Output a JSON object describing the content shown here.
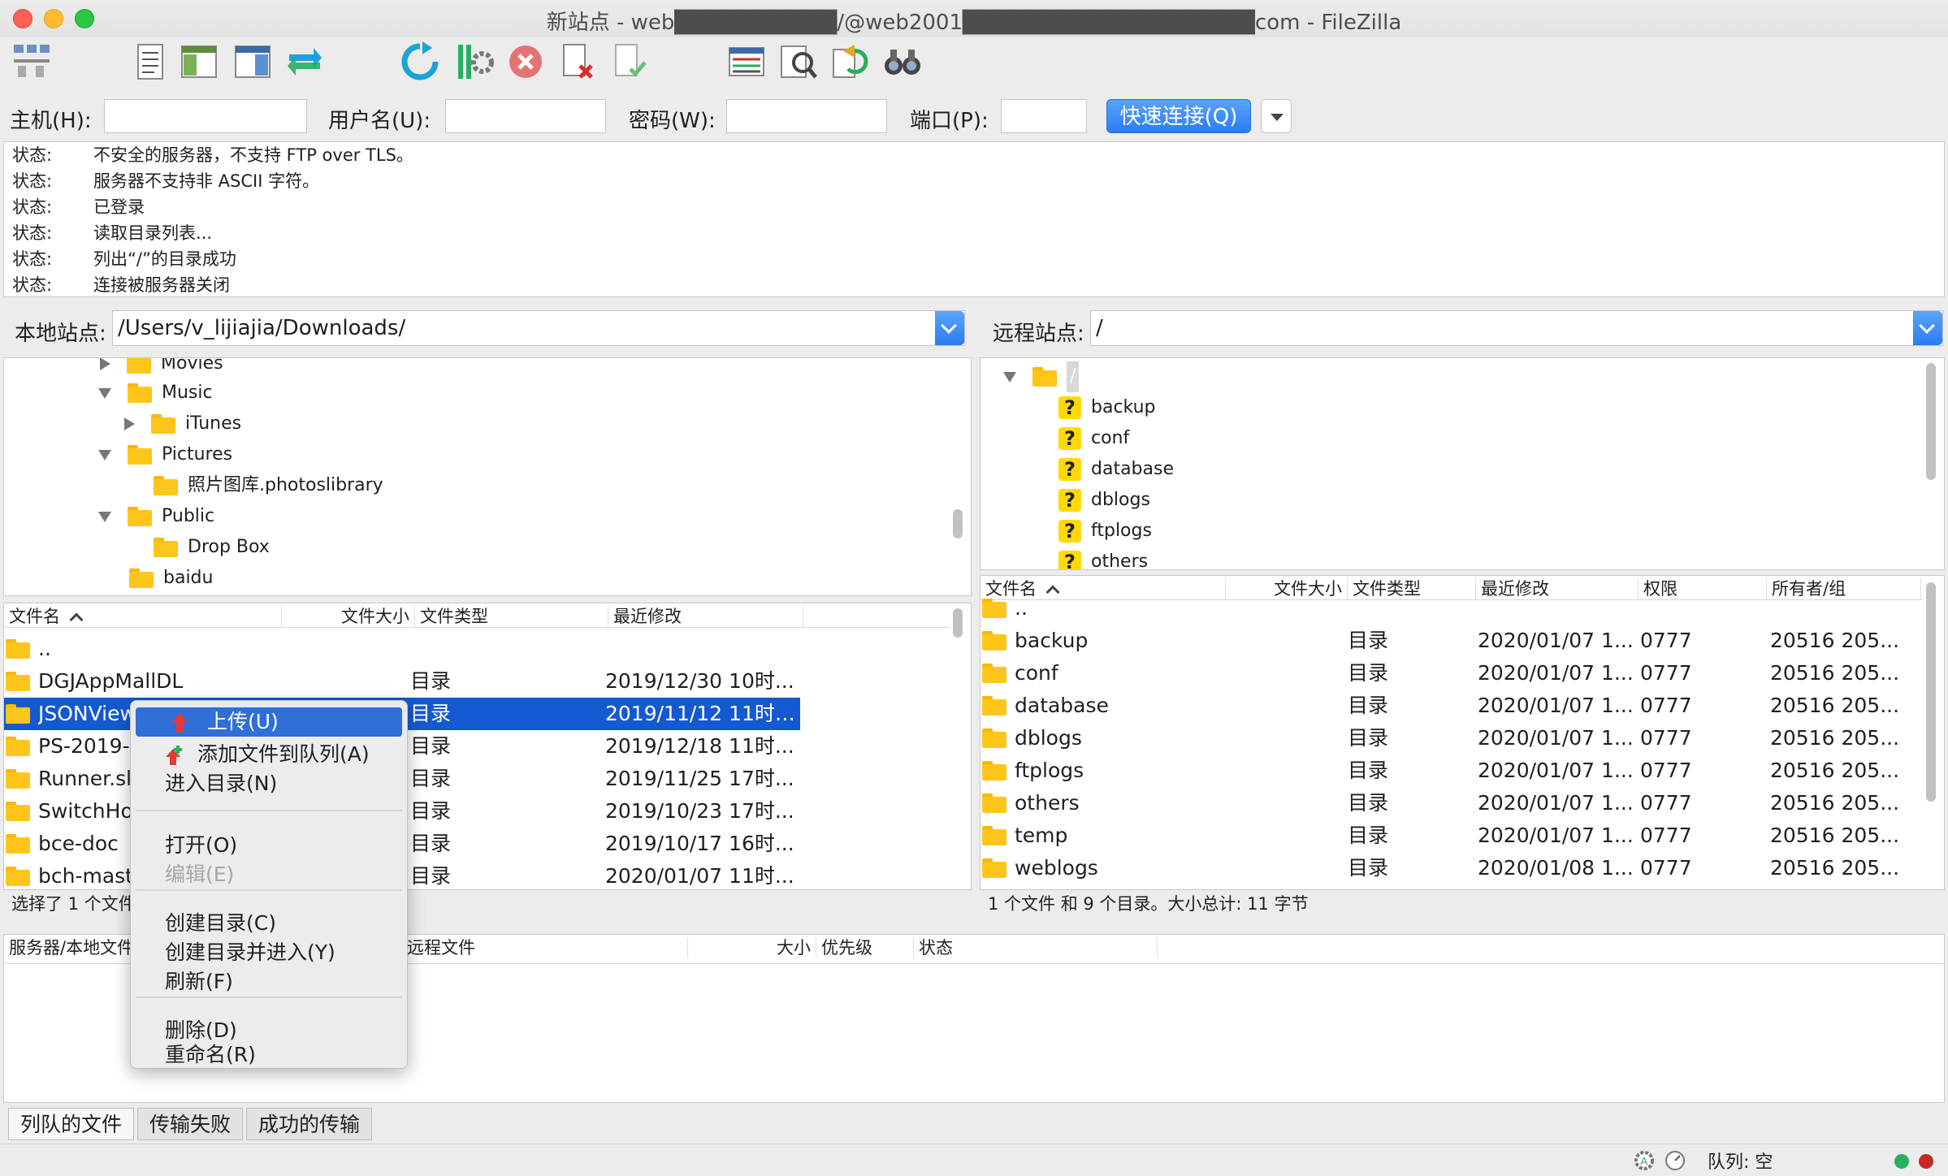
{
  "window": {
    "title": "新站点 - web██████████/@web2001██████████████████com - FileZilla"
  },
  "toolbar": {
    "icons": [
      "site-manager-icon",
      "message-log-icon",
      "local-tree-icon",
      "remote-tree-icon",
      "transfer-queue-icon",
      "refresh-icon",
      "process-queue-icon",
      "cancel-icon",
      "disconnect-icon",
      "reconnect-icon",
      "directory-listing-filters-icon",
      "toggle-sync-browsing-icon",
      "sync-icon",
      "search-icon"
    ]
  },
  "quickconnect": {
    "host_label": "主机(H):",
    "host_value": "",
    "user_label": "用户名(U):",
    "user_value": "",
    "password_label": "密码(W):",
    "password_value": "",
    "port_label": "端口(P):",
    "port_value": "",
    "connect_button": "快速连接(Q)"
  },
  "log": [
    {
      "key": "状态:",
      "msg": "不安全的服务器，不支持 FTP over TLS。"
    },
    {
      "key": "状态:",
      "msg": "服务器不支持非 ASCII 字符。"
    },
    {
      "key": "状态:",
      "msg": "已登录"
    },
    {
      "key": "状态:",
      "msg": "读取目录列表..."
    },
    {
      "key": "状态:",
      "msg": "列出“/”的目录成功"
    },
    {
      "key": "状态:",
      "msg": "连接被服务器关闭"
    }
  ],
  "local": {
    "site_label": "本地站点:",
    "path": "/Users/v_lijiajia/Downloads/",
    "tree": [
      "Movies",
      "Music",
      "iTunes",
      "Pictures",
      "照片图库.photoslibrary",
      "Public",
      "Drop Box",
      "baidu"
    ],
    "headers": {
      "name": "文件名",
      "size": "文件大小",
      "type": "文件类型",
      "modified": "最近修改"
    },
    "files": [
      {
        "name": "..",
        "type": "",
        "modified": ""
      },
      {
        "name": "DGJAppMallDL",
        "type": "目录",
        "modified": "2019/12/30 10时..."
      },
      {
        "name": "JSONView",
        "type": "目录",
        "modified": "2019/11/12 11时1..."
      },
      {
        "name": "PS-2019-",
        "type": "目录",
        "modified": "2019/12/18 11时..."
      },
      {
        "name": "Runner.sk",
        "type": "目录",
        "modified": "2019/11/25 17时..."
      },
      {
        "name": "SwitchHo",
        "type": "目录",
        "modified": "2019/10/23 17时..."
      },
      {
        "name": "bce-doc",
        "type": "目录",
        "modified": "2019/10/17 16时..."
      },
      {
        "name": "bch-mast",
        "type": "目录",
        "modified": "2020/01/07 11时..."
      }
    ],
    "status": "选择了 1 个文件"
  },
  "remote": {
    "site_label": "远程站点:",
    "path": "/",
    "tree_root": "/",
    "tree": [
      "backup",
      "conf",
      "database",
      "dblogs",
      "ftplogs",
      "others"
    ],
    "headers": {
      "name": "文件名",
      "size": "文件大小",
      "type": "文件类型",
      "modified": "最近修改",
      "perms": "权限",
      "owner": "所有者/组"
    },
    "files": [
      {
        "name": "..",
        "type": "",
        "modified": "",
        "perms": "",
        "owner": ""
      },
      {
        "name": "backup",
        "type": "目录",
        "modified": "2020/01/07 1...",
        "perms": "0777",
        "owner": "20516 205..."
      },
      {
        "name": "conf",
        "type": "目录",
        "modified": "2020/01/07 1...",
        "perms": "0777",
        "owner": "20516 205..."
      },
      {
        "name": "database",
        "type": "目录",
        "modified": "2020/01/07 1...",
        "perms": "0777",
        "owner": "20516 205..."
      },
      {
        "name": "dblogs",
        "type": "目录",
        "modified": "2020/01/07 1...",
        "perms": "0777",
        "owner": "20516 205..."
      },
      {
        "name": "ftplogs",
        "type": "目录",
        "modified": "2020/01/07 1...",
        "perms": "0777",
        "owner": "20516 205..."
      },
      {
        "name": "others",
        "type": "目录",
        "modified": "2020/01/07 1...",
        "perms": "0777",
        "owner": "20516 205..."
      },
      {
        "name": "temp",
        "type": "目录",
        "modified": "2020/01/07 1...",
        "perms": "0777",
        "owner": "20516 205..."
      },
      {
        "name": "weblogs",
        "type": "目录",
        "modified": "2020/01/08 1...",
        "perms": "0777",
        "owner": "20516 205..."
      }
    ],
    "status": "1 个文件 和 9 个目录。大小总计: 11 字节"
  },
  "queue": {
    "headers": {
      "server_local": "服务器/本地文件",
      "remote": "远程文件",
      "size": "大小",
      "priority": "优先级",
      "status": "状态"
    }
  },
  "tabs": [
    "列队的文件",
    "传输失败",
    "成功的传输"
  ],
  "footer": {
    "queue_status": "队列: 空"
  },
  "context_menu": {
    "upload": "上传(U)",
    "add_to_queue": "添加文件到队列(A)",
    "enter_dir": "进入目录(N)",
    "open": "打开(O)",
    "edit": "编辑(E)",
    "create_dir": "创建目录(C)",
    "create_dir_enter": "创建目录并进入(Y)",
    "refresh": "刷新(F)",
    "delete": "删除(D)",
    "rename": "重命名(R)"
  },
  "colors": {
    "accent": "#1559d0",
    "button": "#2a7cf0",
    "folder": "#ffc51a"
  }
}
